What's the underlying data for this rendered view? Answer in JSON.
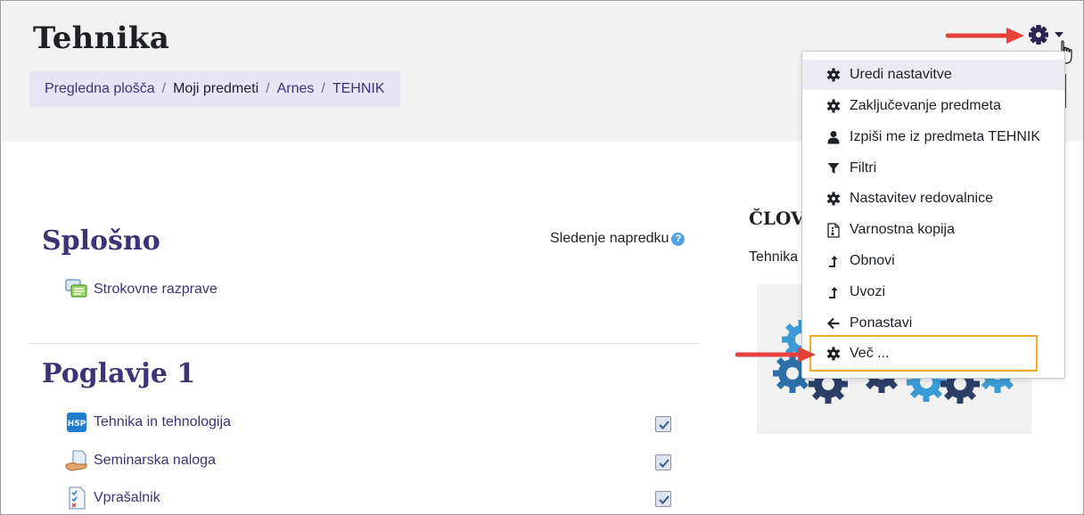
{
  "page": {
    "title": "Tehnika"
  },
  "breadcrumb": {
    "items": [
      {
        "label": "Pregledna plošča",
        "link": true
      },
      {
        "label": "Moji predmeti",
        "link": false
      },
      {
        "label": "Arnes",
        "link": true
      },
      {
        "label": "TEHNIK",
        "link": true
      }
    ],
    "separator": "/"
  },
  "course_menu": {
    "icon": "gear-icon",
    "items": [
      {
        "label": "Uredi nastavitve",
        "icon": "gear-icon",
        "active": true
      },
      {
        "label": "Zaključevanje predmeta",
        "icon": "gear-icon"
      },
      {
        "label": "Izpiši me iz predmeta TEHNIK",
        "icon": "user-icon"
      },
      {
        "label": "Filtri",
        "icon": "filter-icon"
      },
      {
        "label": "Nastavitev redovalnice",
        "icon": "gear-icon"
      },
      {
        "label": "Varnostna kopija",
        "icon": "file-archive-icon"
      },
      {
        "label": "Obnovi",
        "icon": "level-up-icon"
      },
      {
        "label": "Uvozi",
        "icon": "level-up-icon"
      },
      {
        "label": "Ponastavi",
        "icon": "arrow-left-icon"
      },
      {
        "label": "Več ...",
        "icon": "gear-icon",
        "highlighted": true
      }
    ]
  },
  "sections": [
    {
      "title": "Splošno",
      "progress_label": "Sledenje napredku",
      "activities": [
        {
          "label": "Strokovne razprave",
          "icon": "forum-icon"
        }
      ]
    },
    {
      "title": "Poglavje 1",
      "activities": [
        {
          "label": "Tehnika in tehnologija",
          "icon": "h5p-icon",
          "completed": true
        },
        {
          "label": "Seminarska naloga",
          "icon": "assignment-icon",
          "completed": true
        },
        {
          "label": "Vprašalnik",
          "icon": "quiz-icon",
          "completed": true
        }
      ]
    }
  ],
  "side_block": {
    "title": "ČLOV",
    "text": "Tehnika"
  },
  "h5p_badge": "H5P",
  "colors": {
    "brand": "#3c3477",
    "header_bg": "#f2f2f2",
    "breadcrumb_bg": "#e7e5f3",
    "annotation_arrow": "#e5403a",
    "highlight_box": "#f2a92a"
  }
}
